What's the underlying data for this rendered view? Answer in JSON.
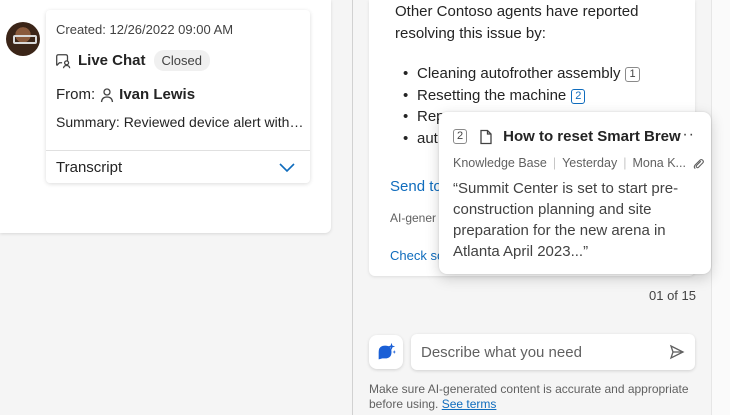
{
  "conversation": {
    "created_label": "Created:",
    "created_value": "12/26/2022 09:00 AM",
    "channel": "Live Chat",
    "status": "Closed",
    "from_label": "From:",
    "from_name": "Ivan Lewis",
    "summary_label": "Summary:",
    "summary_text": "Reviewed device alert with customer and troubleshooting steps",
    "transcript_label": "Transcript",
    "icons": {
      "channel": "chat-person-icon",
      "person": "person-icon",
      "expand": "chevron-down-icon"
    }
  },
  "answer": {
    "intro": "Other Contoso agents have reported resolving this issue by:",
    "steps": [
      {
        "text": "Cleaning autofrother assembly",
        "cite": "1"
      },
      {
        "text": "Resetting the machine",
        "cite": "2"
      },
      {
        "text": "Rep",
        "cite": ""
      },
      {
        "text": "aut",
        "cite": "2"
      }
    ],
    "send_link": "Send to",
    "ai_generated": "AI-gener",
    "check_link": "Check so",
    "count": "01 of 15"
  },
  "popup": {
    "cite": "2",
    "title": "How to reset Smart Brew",
    "more": "···",
    "source": "Knowledge Base",
    "date": "Yesterday",
    "author": "Mona K...",
    "quote": "“Summit Center is set to start pre-construction planning and site preparation for the new arena in Atlanta April 2023...”",
    "icons": {
      "doc": "document-icon",
      "attach": "paperclip-icon"
    }
  },
  "composer": {
    "placeholder": "Describe what you need",
    "disclaimer": "Make sure AI-generated content is accurate and appropriate before using.",
    "terms_link": "See terms",
    "icons": {
      "copilot": "copilot-icon",
      "send": "send-icon"
    }
  },
  "colors": {
    "accent": "#0f6cbd",
    "text": "#242424",
    "muted": "#616161"
  }
}
